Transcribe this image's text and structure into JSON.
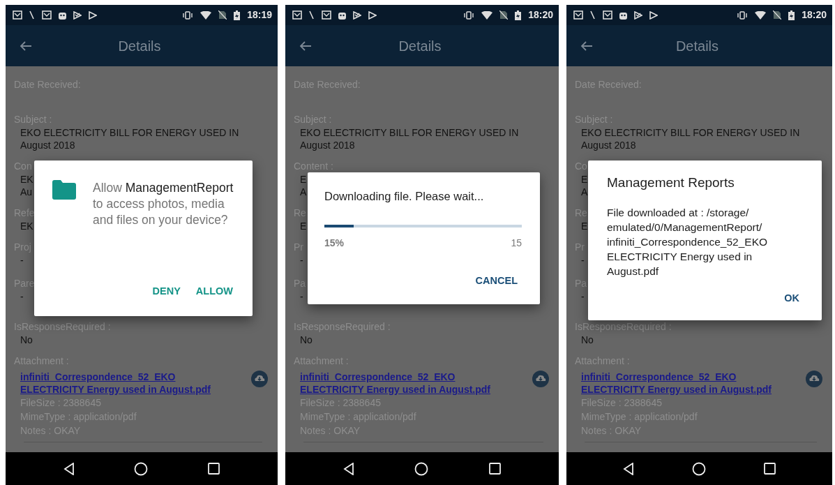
{
  "panels": [
    {
      "status_bar": {
        "time": "18:19"
      },
      "app_bar": {
        "title": "Details"
      },
      "fields": [
        {
          "label": "Date Received:"
        },
        {
          "label": "Subject :",
          "value": "EKO ELECTRICITY BILL FOR ENERGY USED IN August 2018"
        },
        {
          "label": "Con",
          "lines": [
            "EK",
            "Au"
          ]
        },
        {
          "label": "Refe",
          "lines": [
            "EK"
          ]
        },
        {
          "label": "Proj",
          "lines": [
            "-"
          ]
        },
        {
          "label": "Pare",
          "lines": [
            "-"
          ]
        },
        {
          "label": "IsResponseRequired :",
          "lines": [
            "No"
          ]
        }
      ],
      "attachment": {
        "label": "Attachment :",
        "file_name": "infiniti_Correspondence_52_EKO ELECTRICITY Energy used in August.pdf",
        "file_size": "FileSize : 2388645",
        "mime_type": "MimeType : application/pdf",
        "notes": "Notes : OKAY"
      },
      "dialog": {
        "kind": "permission",
        "message": "Allow **ManagementReport** to access photos, media and files on your device?",
        "buttons": [
          "DENY",
          "ALLOW"
        ]
      }
    },
    {
      "status_bar": {
        "time": "18:20"
      },
      "app_bar": {
        "title": "Details"
      },
      "fields": [
        {
          "label": "Date Received:"
        },
        {
          "label": "Subject :",
          "value": "EKO ELECTRICITY BILL FOR ENERGY USED IN August 2018"
        },
        {
          "label": "Content :",
          "lines": [
            "E",
            "A"
          ]
        },
        {
          "label": "Re",
          "lines": [
            "E"
          ]
        },
        {
          "label": "Pr",
          "lines": [
            "-"
          ]
        },
        {
          "label": "Pa",
          "lines": [
            "-"
          ]
        },
        {
          "label": "IsResponseRequired :",
          "lines": [
            "No"
          ]
        }
      ],
      "attachment": {
        "label": "Attachment :",
        "file_name": "infiniti_Correspondence_52_EKO ELECTRICITY Energy used in August.pdf",
        "file_size": "FileSize : 2388645",
        "mime_type": "MimeType : application/pdf",
        "notes": "Notes : OKAY"
      },
      "dialog": {
        "kind": "progress",
        "message": "Downloading file. Please wait...",
        "level": 0.15,
        "percent": "15%",
        "count": "15",
        "buttons": [
          "CANCEL"
        ]
      }
    },
    {
      "status_bar": {
        "time": "18:20"
      },
      "app_bar": {
        "title": "Details"
      },
      "fields": [
        {
          "label": "Date Received:"
        },
        {
          "label": "Subject :",
          "value": "EKO ELECTRICITY BILL FOR ENERGY USED IN August 2018"
        },
        {
          "label": "Co",
          "lines": [
            "E",
            "A"
          ]
        },
        {
          "label": "Re",
          "lines": [
            "E"
          ]
        },
        {
          "label": "Pr",
          "lines": [
            "-"
          ]
        },
        {
          "label": "Pa",
          "lines": [
            "-"
          ]
        },
        {
          "label": "IsResponseRequired :",
          "lines": [
            "No"
          ]
        }
      ],
      "attachment": {
        "label": "Attachment :",
        "file_name": "infiniti_Correspondence_52_EKO ELECTRICITY Energy used in August.pdf",
        "file_size": "FileSize : 2388645",
        "mime_type": "MimeType : application/pdf",
        "notes": "Notes : OKAY"
      },
      "dialog": {
        "kind": "alert",
        "title": "Management Reports",
        "message": "File downloaded at : /storage/ emulated/0/ManagementReport/ infiniti_Correspondence_52_EKO ELECTRICITY Energy used in August.pdf",
        "buttons": [
          "OK"
        ]
      }
    }
  ]
}
